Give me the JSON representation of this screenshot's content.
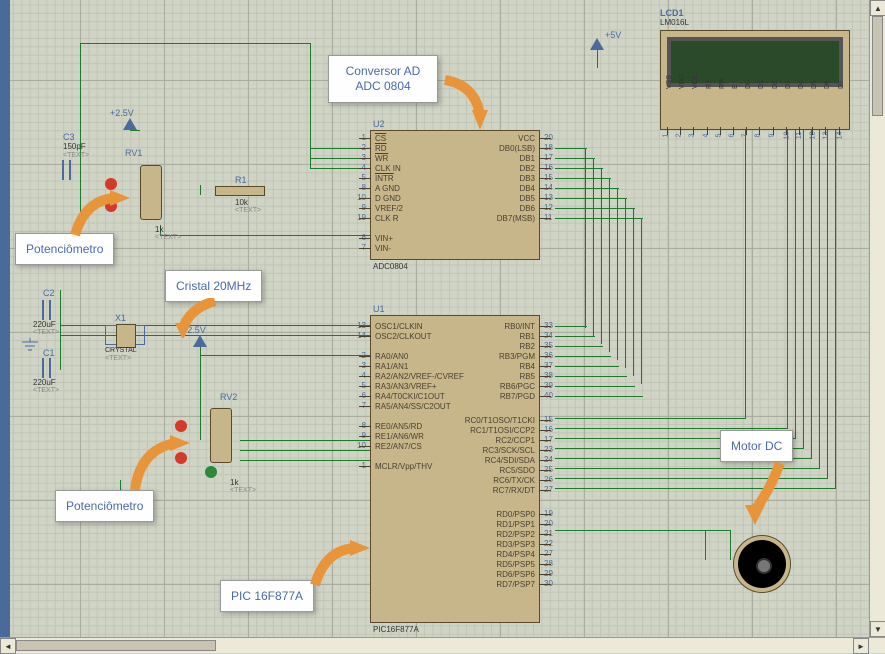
{
  "callouts": {
    "pot1": "Potenciômetro",
    "pot2": "Potenciômetro",
    "crystal": "Cristal 20MHz",
    "adc": "Conversor AD ADC 0804",
    "pic": "PIC 16F877A",
    "motor": "Motor DC"
  },
  "refs": {
    "lcd": {
      "ref": "LCD1",
      "part": "LM016L"
    },
    "c3": {
      "ref": "C3",
      "val": "150pF",
      "txt": "<TEXT>"
    },
    "c2": {
      "ref": "C2",
      "val": "220uF",
      "txt": "<TEXT>"
    },
    "c1": {
      "ref": "C1",
      "val": "220uF",
      "txt": "<TEXT>"
    },
    "r1": {
      "ref": "R1",
      "val": "10k",
      "txt": "<TEXT>"
    },
    "rv1": {
      "ref": "RV1",
      "val": "1k",
      "txt": "<TEXT>"
    },
    "rv2": {
      "ref": "RV2",
      "val": "1k",
      "txt": "<TEXT>"
    },
    "x1": {
      "ref": "X1",
      "val": "CRYSTAL",
      "txt": "<TEXT>"
    },
    "u1": {
      "ref": "U1",
      "part": "PIC16F877A"
    },
    "u2": {
      "ref": "U2",
      "part": "ADC0804"
    }
  },
  "power": {
    "p25a": "+2.5V",
    "p25b": "+2.5V",
    "p5": "+5V"
  },
  "u2_pins_left": [
    {
      "num": "1",
      "name": "CS",
      "ol": true
    },
    {
      "num": "2",
      "name": "RD",
      "ol": true
    },
    {
      "num": "3",
      "name": "WR",
      "ol": true
    },
    {
      "num": "4",
      "name": "CLK IN"
    },
    {
      "num": "5",
      "name": "INTR",
      "ol": true
    },
    {
      "num": "8",
      "name": "A GND"
    },
    {
      "num": "10",
      "name": "D GND"
    },
    {
      "num": "9",
      "name": "VREF/2"
    },
    {
      "num": "19",
      "name": "CLK R"
    },
    {
      "num": "",
      "name": ""
    },
    {
      "num": "6",
      "name": "VIN+"
    },
    {
      "num": "7",
      "name": "VIN-"
    }
  ],
  "u2_pins_right": [
    {
      "num": "20",
      "name": "VCC"
    },
    {
      "num": "18",
      "name": "DB0(LSB)"
    },
    {
      "num": "17",
      "name": "DB1"
    },
    {
      "num": "16",
      "name": "DB2"
    },
    {
      "num": "15",
      "name": "DB3"
    },
    {
      "num": "14",
      "name": "DB4"
    },
    {
      "num": "13",
      "name": "DB5"
    },
    {
      "num": "12",
      "name": "DB6"
    },
    {
      "num": "11",
      "name": "DB7(MSB)"
    }
  ],
  "u1_pins_left": [
    {
      "num": "13",
      "name": "OSC1/CLKIN"
    },
    {
      "num": "14",
      "name": "OSC2/CLKOUT"
    },
    {
      "num": "",
      "name": ""
    },
    {
      "num": "2",
      "name": "RA0/AN0"
    },
    {
      "num": "3",
      "name": "RA1/AN1"
    },
    {
      "num": "4",
      "name": "RA2/AN2/VREF-/CVREF"
    },
    {
      "num": "5",
      "name": "RA3/AN3/VREF+"
    },
    {
      "num": "6",
      "name": "RA4/T0CKI/C1OUT"
    },
    {
      "num": "7",
      "name": "RA5/AN4/SS/C2OUT"
    },
    {
      "num": "",
      "name": ""
    },
    {
      "num": "8",
      "name": "RE0/AN5/RD"
    },
    {
      "num": "9",
      "name": "RE1/AN6/WR"
    },
    {
      "num": "10",
      "name": "RE2/AN7/CS"
    },
    {
      "num": "",
      "name": ""
    },
    {
      "num": "1",
      "name": "MCLR/Vpp/THV"
    }
  ],
  "u1_pins_right_upper": [
    {
      "num": "33",
      "name": "RB0/INT"
    },
    {
      "num": "34",
      "name": "RB1"
    },
    {
      "num": "35",
      "name": "RB2"
    },
    {
      "num": "36",
      "name": "RB3/PGM"
    },
    {
      "num": "37",
      "name": "RB4"
    },
    {
      "num": "38",
      "name": "RB5"
    },
    {
      "num": "39",
      "name": "RB6/PGC"
    },
    {
      "num": "40",
      "name": "RB7/PGD"
    }
  ],
  "u1_pins_right_rc": [
    {
      "num": "15",
      "name": "RC0/T1OSO/T1CKI"
    },
    {
      "num": "16",
      "name": "RC1/T1OSI/CCP2"
    },
    {
      "num": "17",
      "name": "RC2/CCP1"
    },
    {
      "num": "23",
      "name": "RC3/SCK/SCL"
    },
    {
      "num": "24",
      "name": "RC4/SDI/SDA"
    },
    {
      "num": "25",
      "name": "RC5/SDO"
    },
    {
      "num": "26",
      "name": "RC6/TX/CK"
    },
    {
      "num": "27",
      "name": "RC7/RX/DT"
    }
  ],
  "u1_pins_right_rd": [
    {
      "num": "19",
      "name": "RD0/PSP0"
    },
    {
      "num": "20",
      "name": "RD1/PSP1"
    },
    {
      "num": "21",
      "name": "RD2/PSP2"
    },
    {
      "num": "22",
      "name": "RD3/PSP3"
    },
    {
      "num": "27",
      "name": "RD4/PSP4"
    },
    {
      "num": "28",
      "name": "RD5/PSP5"
    },
    {
      "num": "29",
      "name": "RD6/PSP6"
    },
    {
      "num": "30",
      "name": "RD7/PSP7"
    }
  ],
  "lcd_pins": [
    "VSS",
    "VDD",
    "VEE",
    "RS",
    "RW",
    "E",
    "D0",
    "D1",
    "D2",
    "D3",
    "D4",
    "D5",
    "D6",
    "D7"
  ],
  "lcd_nums": [
    "1",
    "2",
    "3",
    "4",
    "5",
    "6",
    "7",
    "8",
    "9",
    "10",
    "11",
    "12",
    "13",
    "14"
  ]
}
